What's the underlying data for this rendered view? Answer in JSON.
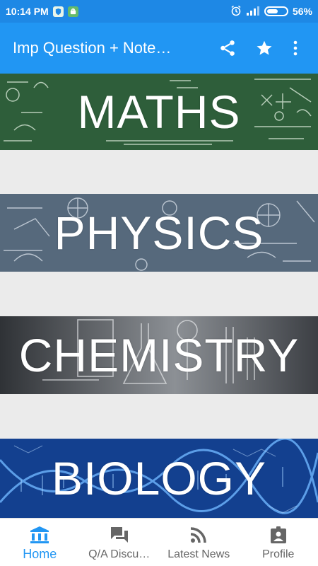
{
  "status_bar": {
    "time": "10:14 PM",
    "battery_text": "56%",
    "battery_level": 0.56,
    "icons": [
      "shield-notification-icon",
      "android-notification-icon",
      "alarm-clock-icon",
      "signal-icon",
      "battery-icon"
    ]
  },
  "app_bar": {
    "title": "Imp Question + Note…",
    "actions": [
      "share-icon",
      "star-icon",
      "more-vert-icon"
    ]
  },
  "subjects": [
    {
      "label": "MATHS",
      "color": "#2e5e3a"
    },
    {
      "label": "PHYSICS",
      "color": "#56697c"
    },
    {
      "label": "CHEMISTRY",
      "color": "#4a4d52"
    },
    {
      "label": "BIOLOGY",
      "color": "#13408f"
    }
  ],
  "bottom_nav": {
    "items": [
      {
        "label": "Home",
        "icon": "bank-icon",
        "active": true
      },
      {
        "label": "Q/A Discu…",
        "icon": "forum-icon",
        "active": false
      },
      {
        "label": "Latest News",
        "icon": "rss-feed-icon",
        "active": false
      },
      {
        "label": "Profile",
        "icon": "profile-badge-icon",
        "active": false
      }
    ]
  },
  "colors": {
    "status_bar": "#1e88e5",
    "app_bar": "#2196f3",
    "accent": "#2196f3",
    "background": "#ebebeb",
    "nav_inactive": "#666666"
  }
}
